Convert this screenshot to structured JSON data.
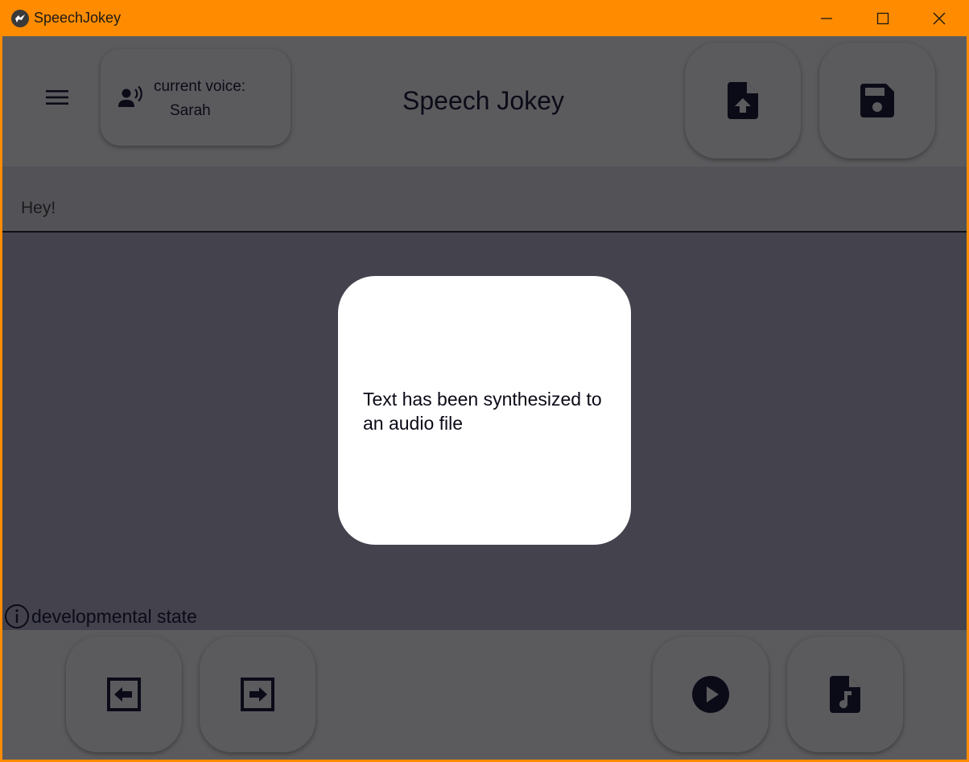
{
  "window": {
    "title": "SpeechJokey",
    "titlebar_color": "#ff8c00",
    "controls": [
      "minimize-icon",
      "maximize-icon",
      "close-icon"
    ]
  },
  "toolbar": {
    "menu_icon": "hamburger-menu-icon",
    "voice_label": "current voice:",
    "voice_name": "Sarah",
    "voice_icon": "record-voice-icon",
    "app_title": "Speech Jokey",
    "upload_icon": "file-upload-icon",
    "save_icon": "floppy-save-icon"
  },
  "editor": {
    "text": "Hey!"
  },
  "status": {
    "icon": "info-icon",
    "text": "developmental state"
  },
  "bottom": {
    "prev_icon": "arrow-left-box-icon",
    "next_icon": "arrow-right-box-icon",
    "play_icon": "play-circle-icon",
    "audio_file_icon": "audio-file-icon"
  },
  "dialog": {
    "message": "Text has been synthesized to an audio file"
  },
  "colors": {
    "background": "#43424d",
    "toolbar": "#5b5b5e",
    "dialog": "#ffffff",
    "icon": "#0b0b18"
  }
}
